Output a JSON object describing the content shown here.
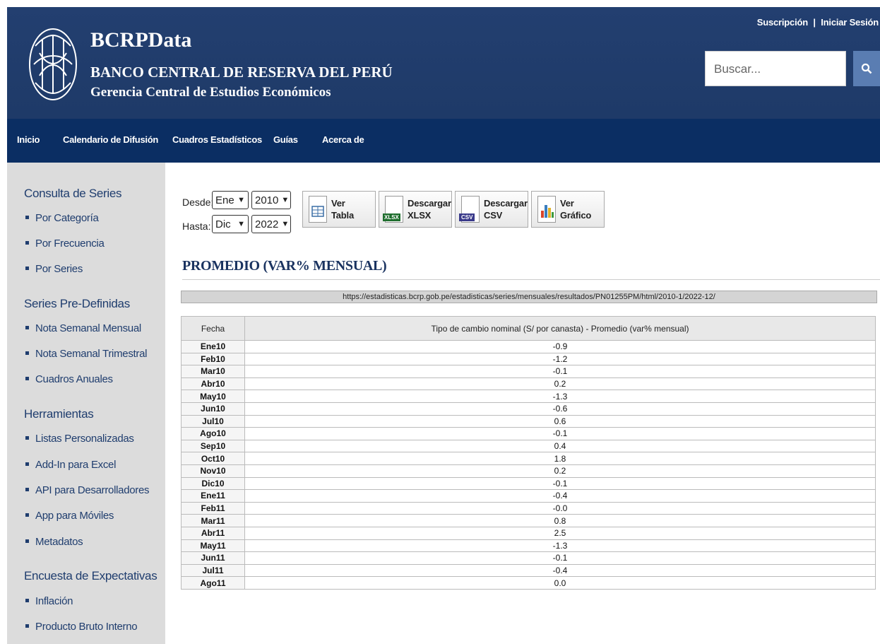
{
  "header": {
    "brand_title": "BCRPData",
    "brand_sub1": "BANCO CENTRAL DE RESERVA DEL PERÚ",
    "brand_sub2": "Gerencia Central de Estudios Económicos",
    "link_subscription": "Suscripción",
    "separator": "|",
    "link_login": "Iniciar Sesión",
    "search_placeholder": "Buscar..."
  },
  "nav": {
    "items": [
      "Inicio",
      "Calendario de Difusión",
      "Cuadros Estadísticos",
      "Guías",
      "Acerca de"
    ]
  },
  "sidebar": {
    "sections": [
      {
        "title": "Consulta de Series",
        "items": [
          "Por Categoría",
          "Por Frecuencia",
          "Por Series"
        ]
      },
      {
        "title": "Series Pre-Definidas",
        "items": [
          "Nota Semanal Mensual",
          "Nota Semanal Trimestral",
          "Cuadros Anuales"
        ]
      },
      {
        "title": "Herramientas",
        "items": [
          "Listas Personalizadas",
          "Add-In para Excel",
          "API para Desarrolladores",
          "App para Móviles",
          "Metadatos"
        ]
      },
      {
        "title": "Encuesta de Expectativas",
        "items": [
          "Inflación",
          "Producto Bruto Interno"
        ]
      }
    ]
  },
  "controls": {
    "desde_label": "Desde:",
    "hasta_label": "Hasta:",
    "desde_month": "Ene",
    "desde_year": "2010",
    "hasta_month": "Dic",
    "hasta_year": "2022",
    "buttons": [
      {
        "line1": "Ver",
        "line2": "Tabla",
        "icon": "table-icon"
      },
      {
        "line1": "Descargar",
        "line2": "XLSX",
        "icon": "xlsx-icon",
        "tag": "XLSX"
      },
      {
        "line1": "Descargar",
        "line2": "CSV",
        "icon": "csv-icon",
        "tag": "CSV"
      },
      {
        "line1": "Ver",
        "line2": "Gráfico",
        "icon": "chart-icon"
      }
    ]
  },
  "page_title": "PROMEDIO (VAR% MENSUAL)",
  "url": "https://estadisticas.bcrp.gob.pe/estadisticas/series/mensuales/resultados/PN01255PM/html/2010-1/2022-12/",
  "table": {
    "headers": [
      "Fecha",
      "Tipo de cambio nominal (S/ por canasta) - Promedio (var% mensual)"
    ],
    "rows": [
      [
        "Ene10",
        "-0.9"
      ],
      [
        "Feb10",
        "-1.2"
      ],
      [
        "Mar10",
        "-0.1"
      ],
      [
        "Abr10",
        "0.2"
      ],
      [
        "May10",
        "-1.3"
      ],
      [
        "Jun10",
        "-0.6"
      ],
      [
        "Jul10",
        "0.6"
      ],
      [
        "Ago10",
        "-0.1"
      ],
      [
        "Sep10",
        "0.4"
      ],
      [
        "Oct10",
        "1.8"
      ],
      [
        "Nov10",
        "0.2"
      ],
      [
        "Dic10",
        "-0.1"
      ],
      [
        "Ene11",
        "-0.4"
      ],
      [
        "Feb11",
        "-0.0"
      ],
      [
        "Mar11",
        "0.8"
      ],
      [
        "Abr11",
        "2.5"
      ],
      [
        "May11",
        "-1.3"
      ],
      [
        "Jun11",
        "-0.1"
      ],
      [
        "Jul11",
        "-0.4"
      ],
      [
        "Ago11",
        "0.0"
      ]
    ]
  },
  "colors": {
    "header_bg": "#1f3d6e",
    "nav_bg": "#0b2e63",
    "sidebar_bg": "#dcdcdc",
    "search_button": "#5a7db2"
  }
}
